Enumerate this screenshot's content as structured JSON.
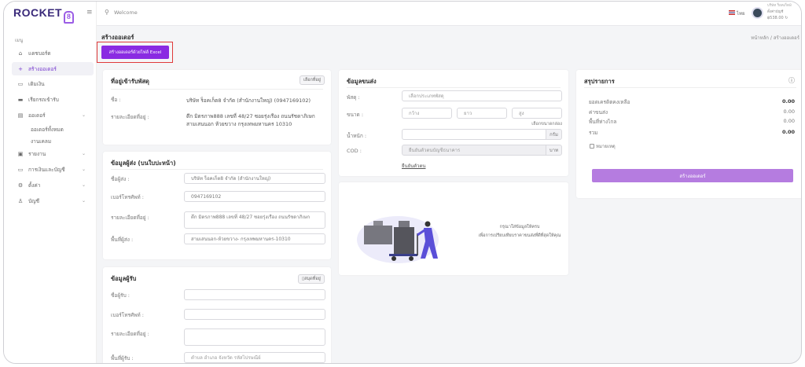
{
  "app": {
    "logo": "ROCKET",
    "logo_mark": "8"
  },
  "header": {
    "search_placeholder": "Welcome",
    "language": "ไทย",
    "user_name": "บริษัท ร็อคเก็ต8",
    "user_role": "ตั้งค่าบัญชี",
    "balance": "฿538.00"
  },
  "sidebar": {
    "menu_label": "เมนู",
    "items": [
      {
        "label": "แดชบอร์ด",
        "icon": "home-icon"
      },
      {
        "label": "สร้างออเดอร์",
        "icon": "plus-icon",
        "active": true
      },
      {
        "label": "เติมเงิน",
        "icon": "wallet-icon"
      },
      {
        "label": "เรียกรถเข้ารับ",
        "icon": "truck-icon"
      },
      {
        "label": "ออเดอร์",
        "icon": "orders-icon",
        "expandable": true
      },
      {
        "label": "รายงาน",
        "icon": "report-icon",
        "expandable": true
      },
      {
        "label": "การเงินและบัญชี",
        "icon": "finance-icon",
        "expandable": true
      },
      {
        "label": "ตั้งค่า",
        "icon": "settings-icon",
        "expandable": true
      },
      {
        "label": "บัญชี",
        "icon": "user-icon",
        "expandable": true
      }
    ],
    "sub_items": [
      "ออเดอร์ทั้งหมด",
      "งานเคลม"
    ]
  },
  "page": {
    "title": "สร้างออเดอร์",
    "excel_button": "สร้างออเดอร์ด้วยไฟล์ Excel",
    "breadcrumb": [
      "หน้าหลัก",
      "/",
      "สร้างออเดอร์"
    ]
  },
  "pickup": {
    "title": "ที่อยู่เข้ารับพัสดุ",
    "select_button": "เลือกที่อยู่",
    "name_label": "ชื่อ :",
    "name_value": "บริษัท ร็อคเก็ต8 จำกัด (สำนักงานใหญ่)   (0947169102)",
    "address_label": "รายละเอียดที่อยู่ :",
    "address_value": "ตึก มิตรภาพ888 เลขที่ 48/27 ซอยรุ่งเรือง ถนนรัชดาภิเษก สามเสนนอก ห้วยขวาง กรุงเทพมหานคร 10310"
  },
  "sender": {
    "title": "ข้อมูลผู้ส่ง (บนใบปะหน้า)",
    "name_label": "ชื่อผู้ส่ง :",
    "name_value": "บริษัท ร็อคเก็ต8 จำกัด (สำนักงานใหญ่)",
    "phone_label": "เบอร์โทรศัพท์ :",
    "phone_value": "0947169102",
    "address_label": "รายละเอียดที่อยู่ :",
    "address_value": "ตึก มิตรภาพ888 เลขที่ 48/27 ซอยรุ่งเรือง ถนนรัชดาภิเษก",
    "area_label": "พื้นที่ผู้ส่ง :",
    "area_value": "สามเสนนอก-ห้วยขวาง- กรุงเทพมหานคร-10310"
  },
  "receiver": {
    "title": "ข้อมูลผู้รับ",
    "book_button": "สมุดที่อยู่",
    "name_label": "ชื่อผู้รับ :",
    "phone_label": "เบอร์โทรศัพท์ :",
    "address_label": "รายละเอียดที่อยู่ :",
    "area_label": "พื้นที่ผู้รับ :",
    "area_placeholder": "ตำบล อำเภอ จังหวัด รหัสไปรษณีย์"
  },
  "shipping": {
    "title": "ข้อมูลขนส่ง",
    "parcel_label": "พัสดุ :",
    "parcel_placeholder": "เลือกประเภทพัสดุ",
    "size_label": "ขนาด :",
    "width_placeholder": "กว้าง",
    "length_placeholder": "ยาว",
    "height_placeholder": "สูง",
    "box_size_link": "เลือกขนาดกล่อง",
    "weight_label": "น้ำหนัก :",
    "weight_unit": "กรัม",
    "cod_label": "COD :",
    "cod_placeholder": "ยืนยันตัวตนบัญชีธนาคาร",
    "cod_unit": "บาท",
    "verify_link": "ยืนยันตัวตน"
  },
  "empty_state": {
    "line1": "กรุณาใส่ข้อมูลให้ครบ",
    "line2": "เพื่อการเปรียบเทียบราคาขนส่งที่ดีที่สุดให้คุณ"
  },
  "summary": {
    "title": "สรุปรายการ",
    "rows": [
      {
        "label": "ยอดเครดิตคงเหลือ",
        "value": "0.00"
      },
      {
        "label": "ค่าขนส่ง",
        "value": "0.00"
      },
      {
        "label": "พื้นที่ห่างไกล",
        "value": "0.00"
      },
      {
        "label": "รวม",
        "value": "0.00"
      }
    ],
    "note_label": "หมายเหตุ",
    "create_button": "สร้างออเดอร์"
  },
  "colors": {
    "primary": "#8a2be2",
    "primary_light": "#b57ce0",
    "highlight": "#e03a3a"
  }
}
